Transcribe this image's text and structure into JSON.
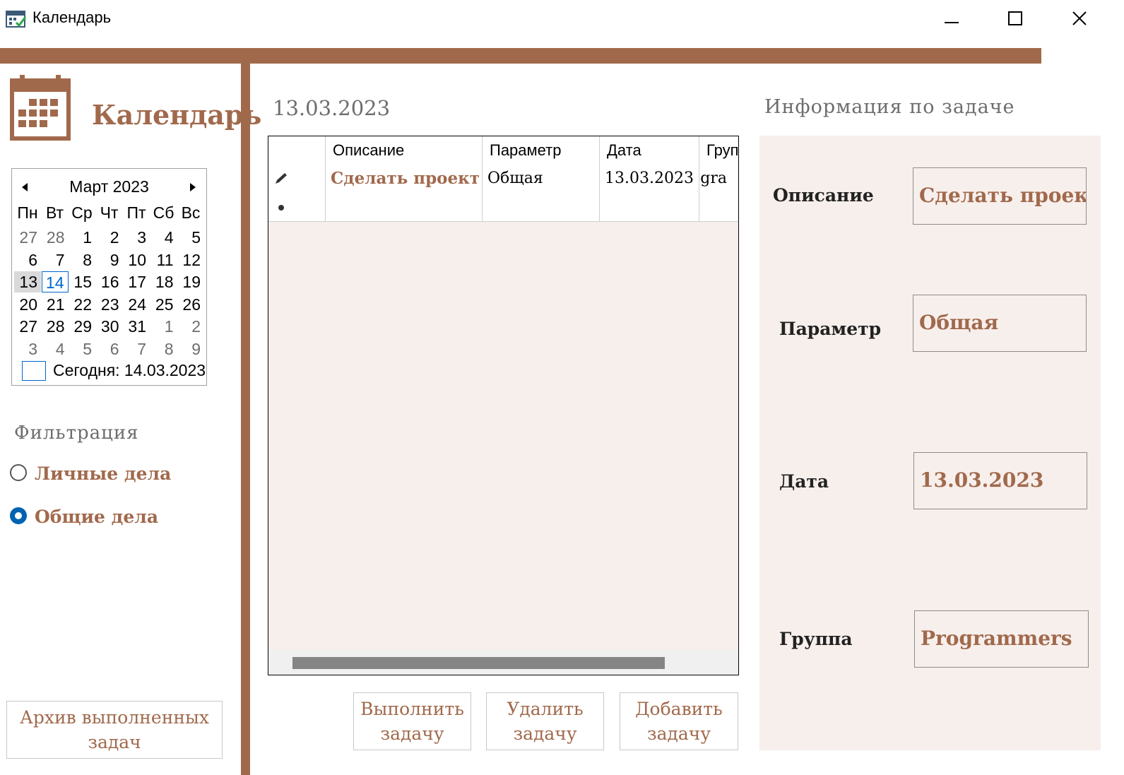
{
  "window": {
    "title": "Календарь",
    "controls": [
      "minimize",
      "maximize",
      "close"
    ]
  },
  "sidebar": {
    "logo_title": "Календарь",
    "calendar": {
      "month_label": "Март 2023",
      "weekdays": [
        "Пн",
        "Вт",
        "Ср",
        "Чт",
        "Пт",
        "Сб",
        "Вс"
      ],
      "weeks": [
        [
          "27",
          "28",
          "1",
          "2",
          "3",
          "4",
          "5"
        ],
        [
          "6",
          "7",
          "8",
          "9",
          "10",
          "11",
          "12"
        ],
        [
          "13",
          "14",
          "15",
          "16",
          "17",
          "18",
          "19"
        ],
        [
          "20",
          "21",
          "22",
          "23",
          "24",
          "25",
          "26"
        ],
        [
          "27",
          "28",
          "29",
          "30",
          "31",
          "1",
          "2"
        ],
        [
          "3",
          "4",
          "5",
          "6",
          "7",
          "8",
          "9"
        ]
      ],
      "selected_day": "13",
      "today_day": "14",
      "today_label": "Сегодня: 14.03.2023"
    },
    "filter": {
      "title": "Фильтрация",
      "options": [
        {
          "label": "Личные дела",
          "checked": false
        },
        {
          "label": "Общие дела",
          "checked": true
        }
      ]
    },
    "archive_button": "Архив выполненных задач"
  },
  "main": {
    "date_heading": "13.03.2023",
    "grid": {
      "columns": [
        "Описание",
        "Параметр",
        "Дата",
        "Груп"
      ],
      "rows": [
        [
          "Сделать проект",
          "Общая",
          "13.03.2023",
          "ogra"
        ]
      ]
    },
    "buttons": {
      "complete": "Выполнить задачу",
      "delete": "Удалить задачу",
      "add": "Добавить задачу"
    }
  },
  "info": {
    "title": "Информация по задаче",
    "fields": [
      {
        "label": "Описание",
        "value": "Сделать проект"
      },
      {
        "label": "Параметр",
        "value": "Общая"
      },
      {
        "label": "Дата",
        "value": "13.03.2023"
      },
      {
        "label": "Группа",
        "value": "Programmers"
      }
    ]
  },
  "colors": {
    "accent": "#a1694c",
    "panel_bg": "#f7efec",
    "muted_text": "#6d6d6d",
    "radio_selected": "#0063b1",
    "today_outline": "#0066cc"
  }
}
